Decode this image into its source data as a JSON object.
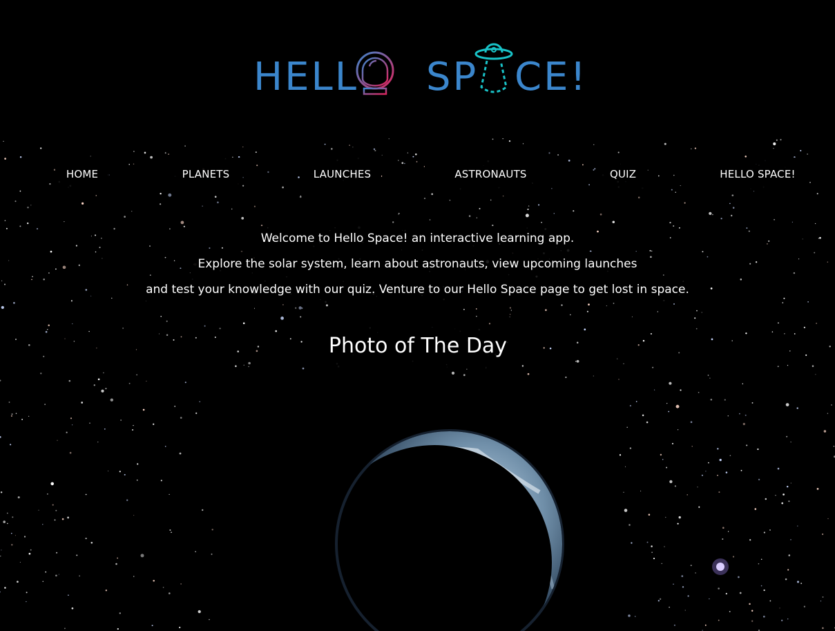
{
  "header": {
    "logo_word_1": "HELL",
    "logo_word_2a": "SP",
    "logo_word_2b": "CE!",
    "logo_alt": "HELLO SPACE!",
    "helmet_icon": "astronaut-helmet-icon",
    "ufo_icon": "ufo-icon"
  },
  "nav": {
    "items": [
      {
        "label": "HOME"
      },
      {
        "label": "PLANETS"
      },
      {
        "label": "LAUNCHES"
      },
      {
        "label": "ASTRONAUTS"
      },
      {
        "label": "QUIZ"
      },
      {
        "label": "HELLO SPACE!"
      }
    ]
  },
  "intro": {
    "line1": "Welcome to Hello Space! an interactive learning app.",
    "line2": "Explore the solar system, learn about astronauts, view upcoming launches",
    "line3": "and test your knowledge with our quiz. Venture to our Hello Space page to get lost in space."
  },
  "photo_of_day": {
    "title": "Photo of The Day",
    "image_subject": "earth-crescent-image"
  },
  "colors": {
    "logo_blue": "#3b86cc",
    "helmet_gradient_start": "#3b86cc",
    "helmet_gradient_end": "#e0245e",
    "ufo_teal": "#19c3c8",
    "background": "#000000"
  }
}
